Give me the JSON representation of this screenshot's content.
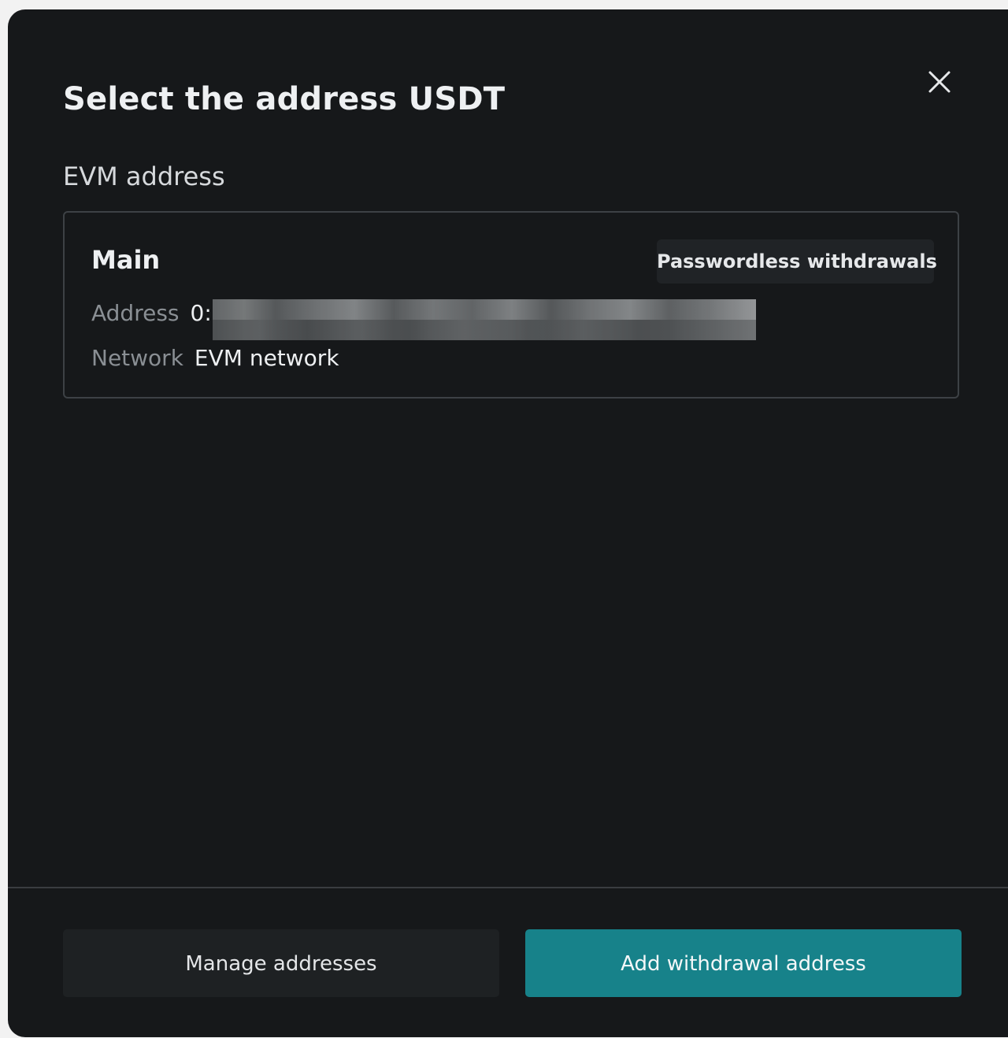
{
  "modal": {
    "title": "Select the address USDT",
    "close_icon": "close-icon"
  },
  "section": {
    "label": "EVM address"
  },
  "address_card": {
    "name": "Main",
    "badge": "Passwordless withdrawals",
    "address_label": "Address",
    "address_value": "0:",
    "network_label": "Network",
    "network_value": "EVM network"
  },
  "footer": {
    "manage_label": "Manage addresses",
    "add_label": "Add withdrawal address"
  },
  "colors": {
    "background": "#16181a",
    "primary_button": "#17828a",
    "secondary_button": "#1e2123",
    "card_border": "#3d4145"
  }
}
